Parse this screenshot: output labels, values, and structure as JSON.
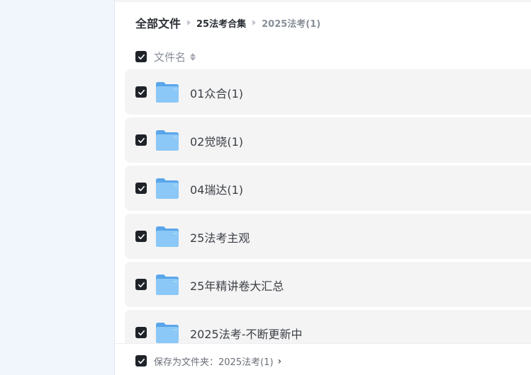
{
  "breadcrumb": {
    "root": "全部文件",
    "middle": "25法考合集",
    "current": "2025法考(1)"
  },
  "header": {
    "select_all_checked": true,
    "column_label": "文件名"
  },
  "files": [
    {
      "name": "01众合(1)",
      "type": "folder",
      "checked": true
    },
    {
      "name": "02觉晓(1)",
      "type": "folder",
      "checked": true
    },
    {
      "name": "04瑞达(1)",
      "type": "folder",
      "checked": true
    },
    {
      "name": "25法考主观",
      "type": "folder",
      "checked": true
    },
    {
      "name": "25年精讲卷大汇总",
      "type": "folder",
      "checked": true
    },
    {
      "name": "2025法考-不断更新中",
      "type": "folder",
      "checked": true
    }
  ],
  "footer": {
    "save_label": "保存为文件夹：",
    "save_target": "2025法考(1)",
    "checked": true
  },
  "colors": {
    "sidebar_bg": "#f1f5fc",
    "row_bg": "#f4f4f4",
    "checkbox": "#1f2329",
    "folder": "#6fb3f0"
  }
}
